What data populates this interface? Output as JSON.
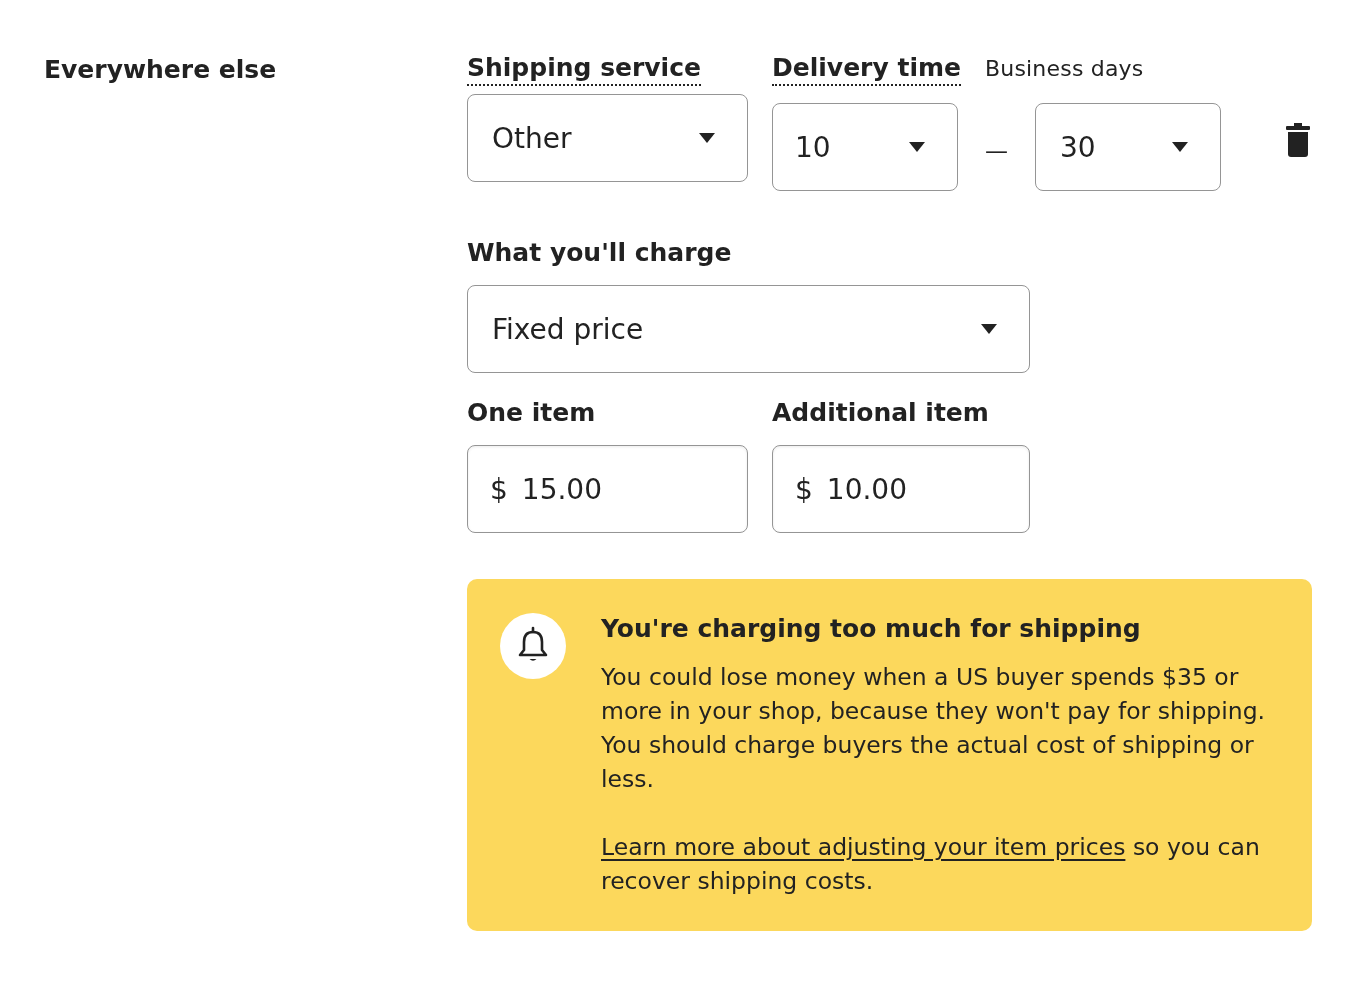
{
  "section": {
    "label": "Everywhere else"
  },
  "shipping_service": {
    "label": "Shipping service",
    "value": "Other"
  },
  "delivery_time": {
    "label": "Delivery time",
    "unit_label": "Business days",
    "min": "10",
    "separator": "—",
    "max": "30"
  },
  "charge": {
    "label": "What you'll charge",
    "value": "Fixed price"
  },
  "prices": [
    {
      "label": "One item",
      "currency": "$",
      "value": "15.00"
    },
    {
      "label": "Additional item",
      "currency": "$",
      "value": "10.00"
    }
  ],
  "alert": {
    "title": "You're charging too much for shipping",
    "body": "You could lose money when a US buyer spends $35 or more in your shop, because they won't pay for shipping. You should charge buyers the actual cost of shipping or less.",
    "link": "Learn more about adjusting your item prices",
    "link_tail": "so you can recover shipping costs."
  }
}
